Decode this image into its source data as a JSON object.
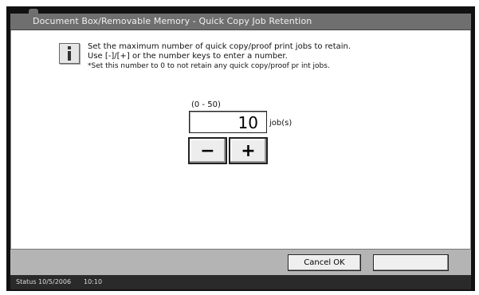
{
  "window": {
    "title": "Document Box/Removable Memory - Quick Copy Job Retention"
  },
  "message": {
    "icon": "info-icon",
    "line1": "Set the maximum number of quick copy/proof print jobs to retain.",
    "line2": "Use [-]/[+] or the number keys to enter a number.",
    "line3": "*Set this number to 0 to not retain any quick copy/proof pr int jobs."
  },
  "setting": {
    "range_label": "(0 - 50)",
    "value": "10",
    "unit": "job(s)",
    "minus_label": "−",
    "plus_label": "+"
  },
  "footer": {
    "cancel_ok_label": "Cancel OK",
    "blank_button_label": ""
  },
  "status": {
    "date": "Status 10/5/2006",
    "time": "10:10"
  }
}
